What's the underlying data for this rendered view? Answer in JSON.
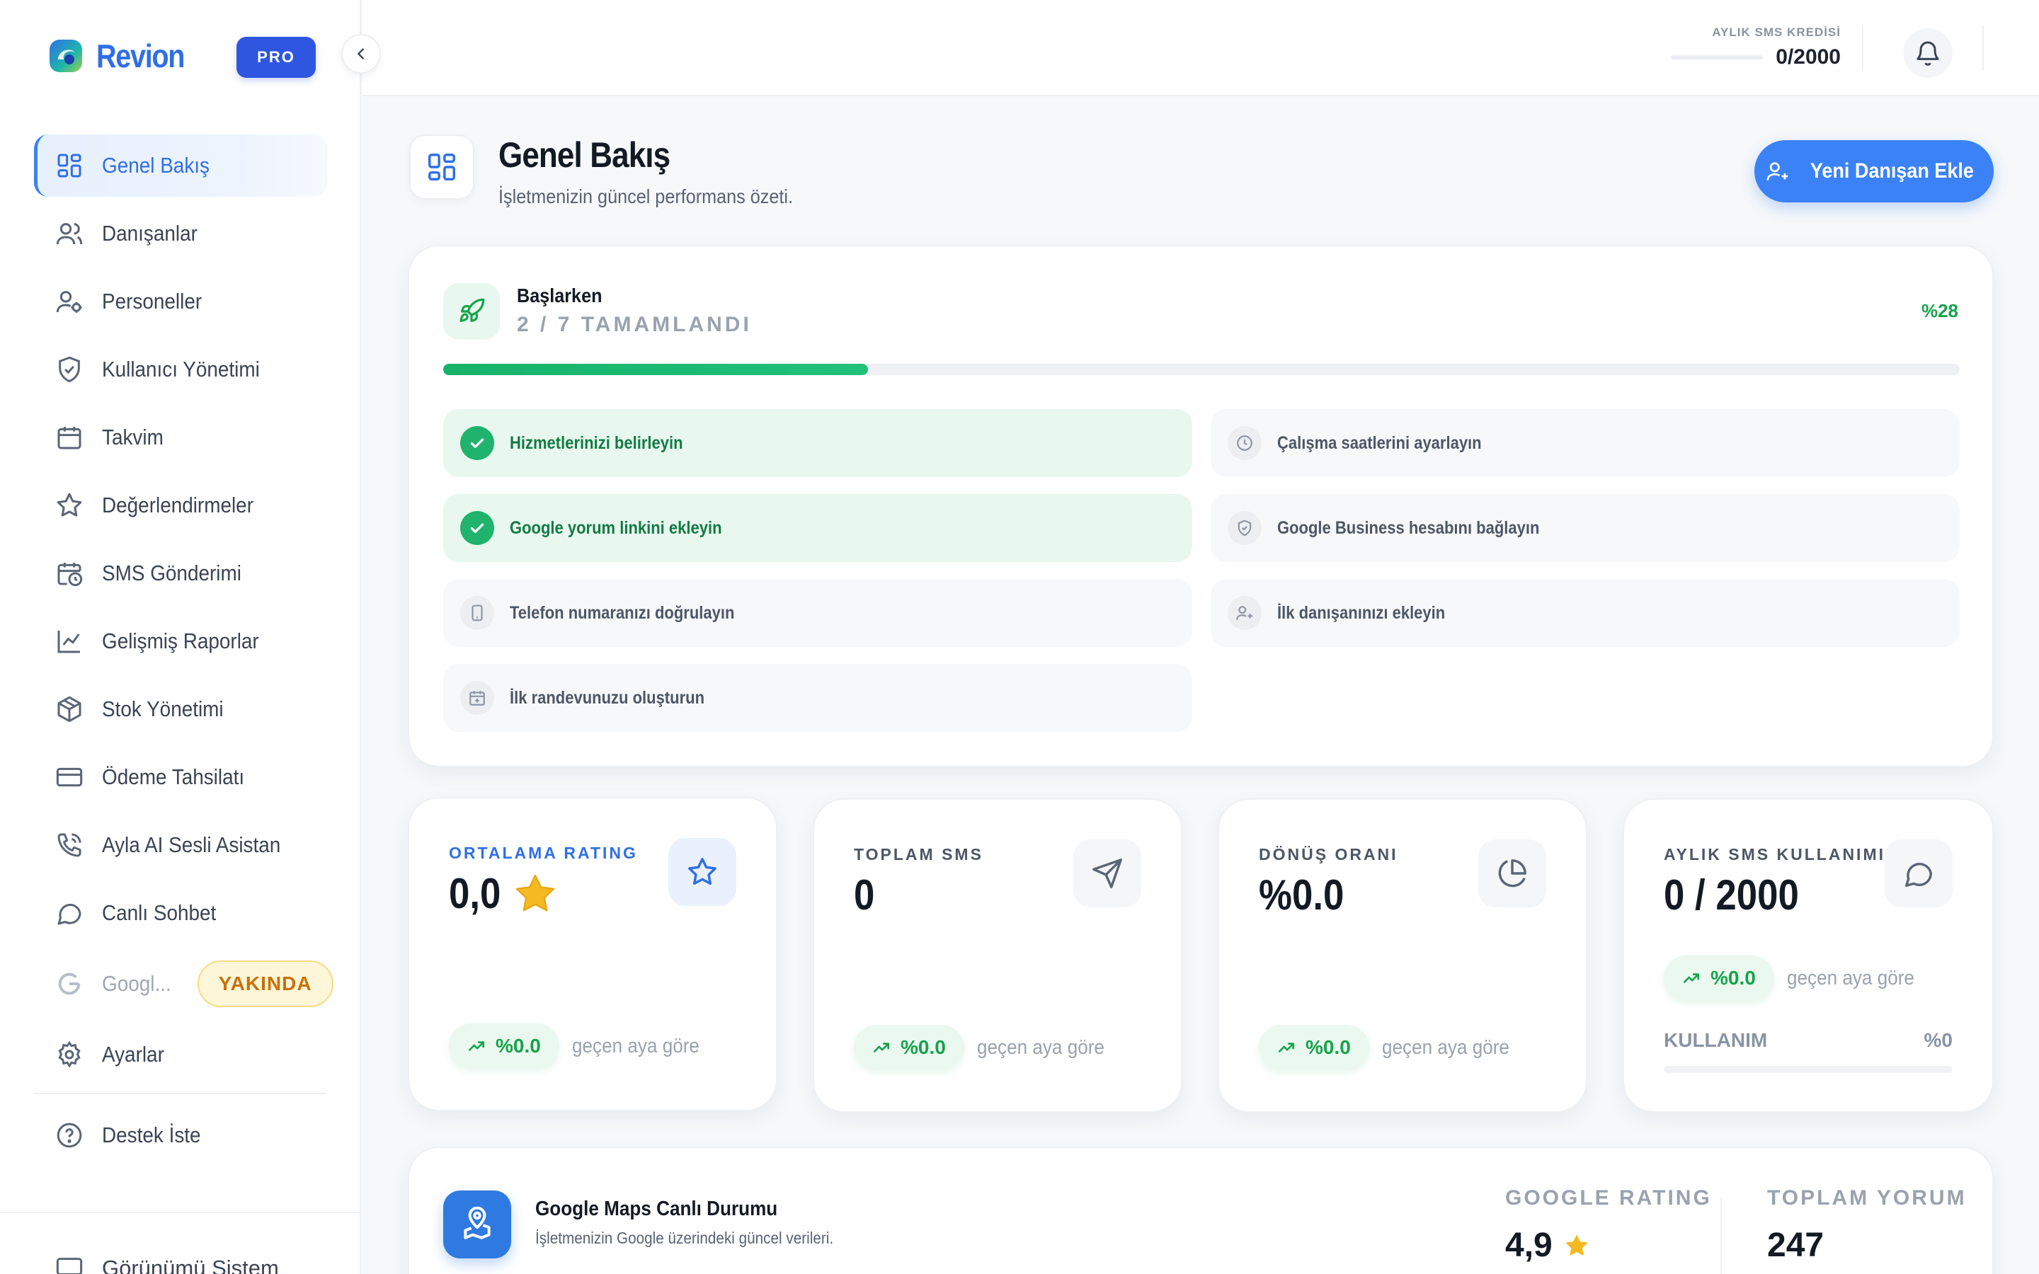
{
  "sidebar": {
    "brand": "Revion",
    "plan_badge": "PRO",
    "items": [
      {
        "label": "Genel Bakış",
        "icon": "dashboard-icon"
      },
      {
        "label": "Danışanlar",
        "icon": "users-icon"
      },
      {
        "label": "Personeller",
        "icon": "user-settings-icon"
      },
      {
        "label": "Kullanıcı Yönetimi",
        "icon": "shield-icon"
      },
      {
        "label": "Takvim",
        "icon": "calendar-icon"
      },
      {
        "label": "Değerlendirmeler",
        "icon": "star-icon"
      },
      {
        "label": "SMS Gönderimi",
        "icon": "calendar-clock-icon"
      },
      {
        "label": "Gelişmiş Raporlar",
        "icon": "line-chart-icon"
      },
      {
        "label": "Stok Yönetimi",
        "icon": "box-icon"
      },
      {
        "label": "Ödeme Tahsilatı",
        "icon": "credit-card-icon"
      },
      {
        "label": "Ayla AI Sesli Asistan",
        "icon": "phone-call-icon"
      },
      {
        "label": "Canlı Sohbet",
        "icon": "chat-icon"
      },
      {
        "label": "Googl...",
        "icon": "google-icon",
        "badge": "YAKINDA"
      },
      {
        "label": "Ayarlar",
        "icon": "gear-icon"
      },
      {
        "label": "Destek İste",
        "icon": "help-circle-icon"
      }
    ],
    "bottom_item": "Görünümü Sistem"
  },
  "topbar": {
    "sms_credit_caption": "AYLIK SMS KREDİSİ",
    "sms_credit_value": "0/2000"
  },
  "header": {
    "title": "Genel Bakış",
    "subtitle": "İşletmenizin güncel performans özeti.",
    "cta": "Yeni Danışan Ekle"
  },
  "onboarding": {
    "title": "Başlarken",
    "progress_text": "2 / 7 TAMAMLANDI",
    "percent_text": "%28",
    "progress_fraction": 0.28,
    "tasks": [
      {
        "label": "Hizmetlerinizi belirleyin",
        "done": true
      },
      {
        "label": "Çalışma saatlerini ayarlayın",
        "done": false
      },
      {
        "label": "Google yorum linkini ekleyin",
        "done": true
      },
      {
        "label": "Google Business hesabını bağlayın",
        "done": false
      },
      {
        "label": "Telefon numaranızı doğrulayın",
        "done": false
      },
      {
        "label": "İlk danışanınızı ekleyin",
        "done": false
      },
      {
        "label": "İlk randevunuzu oluşturun",
        "done": false
      }
    ]
  },
  "stats": [
    {
      "caption": "ORTALAMA RATING",
      "value": "0,0",
      "trend": "%0.0",
      "trend_ref": "geçen aya göre"
    },
    {
      "caption": "TOPLAM SMS",
      "value": "0",
      "trend": "%0.0",
      "trend_ref": "geçen aya göre"
    },
    {
      "caption": "DÖNÜŞ ORANI",
      "value": "%0.0",
      "trend": "%0.0",
      "trend_ref": "geçen aya göre"
    },
    {
      "caption": "AYLIK SMS KULLANIMI",
      "value": "0 / 2000",
      "trend": "%0.0",
      "trend_ref": "geçen aya göre",
      "usage_label": "KULLANIM",
      "usage_value": "%0"
    }
  ],
  "maps": {
    "title": "Google Maps Canlı Durumu",
    "subtitle": "İşletmenizin Google üzerindeki güncel verileri.",
    "rating_caption": "GOOGLE RATING",
    "rating_value": "4,9",
    "reviews_caption": "TOPLAM YORUM",
    "reviews_value": "247"
  },
  "colors": {
    "accent": "#3b82f6",
    "brand": "#2f6fe6",
    "success": "#16a34a",
    "warning": "#c7710a"
  }
}
